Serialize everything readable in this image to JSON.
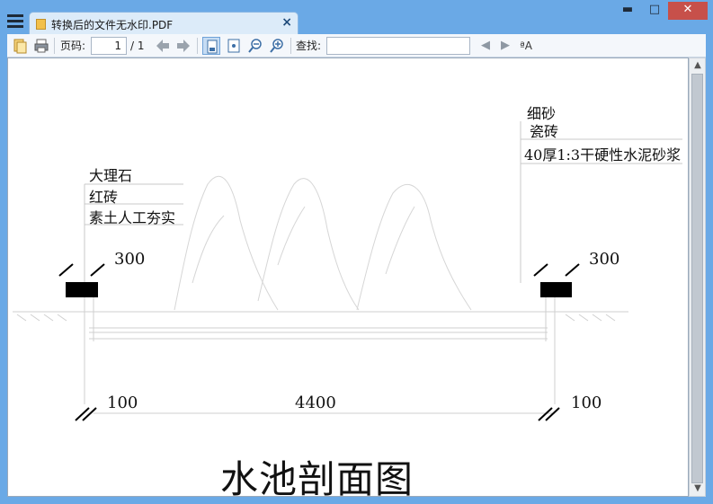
{
  "window": {
    "tab_title": "转换后的文件无水印.PDF",
    "close_tab_glyph": "×",
    "minimize_glyph": "▬",
    "maximize_glyph": "□",
    "close_glyph": "✕"
  },
  "toolbar": {
    "page_label": "页码:",
    "current_page": "1",
    "total_pages": "/ 1",
    "search_label": "查找:",
    "search_value": "",
    "prev_glyph": "◀",
    "next_glyph": "▶",
    "font_glyph": "ªA"
  },
  "drawing": {
    "left_layers": [
      "大理石",
      "红砖",
      "素土人工夯实"
    ],
    "right_layers": [
      "细砂",
      "瓷砖",
      "40厚1:3干硬性水泥砂浆"
    ],
    "dim_left_top": "300",
    "dim_right_top": "300",
    "dim_left_bottom": "100",
    "dim_center": "4400",
    "dim_right_bottom": "100",
    "title": "水池剖面图"
  },
  "scrollbar": {
    "up_glyph": "▲",
    "down_glyph": "▼"
  }
}
